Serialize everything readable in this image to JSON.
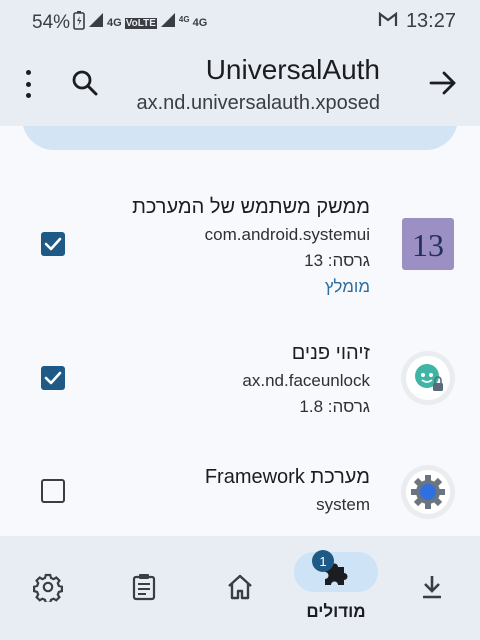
{
  "status_bar": {
    "battery": "54%",
    "network_1": "4G",
    "volte": "VoLTE",
    "network_2": "4G",
    "network_2_sup": "4G",
    "time": "13:27"
  },
  "app_bar": {
    "title": "UniversalAuth",
    "subtitle": "ax.nd.universalauth.xposed"
  },
  "modules": [
    {
      "title": "ממשק משתמש של המערכת",
      "package": "com.android.systemui",
      "version": "גרסה: 13",
      "link": "מומלץ",
      "checked": true,
      "icon": "android-13-icon"
    },
    {
      "title": "זיהוי פנים",
      "package": "ax.nd.faceunlock",
      "version": "גרסה: 1.8",
      "checked": true,
      "icon": "face-unlock-icon"
    },
    {
      "title": "מערכת Framework",
      "package": "system",
      "checked": false,
      "icon": "gear-icon"
    }
  ],
  "bottom_nav": {
    "active_label": "מודולים",
    "badge": "1",
    "items": [
      "settings-icon",
      "logs-icon",
      "home-icon",
      "modules-icon",
      "download-icon"
    ]
  },
  "colors": {
    "accent": "#1e5a85",
    "bar_bg": "#e8edf3",
    "pill": "#cfe3f6"
  }
}
